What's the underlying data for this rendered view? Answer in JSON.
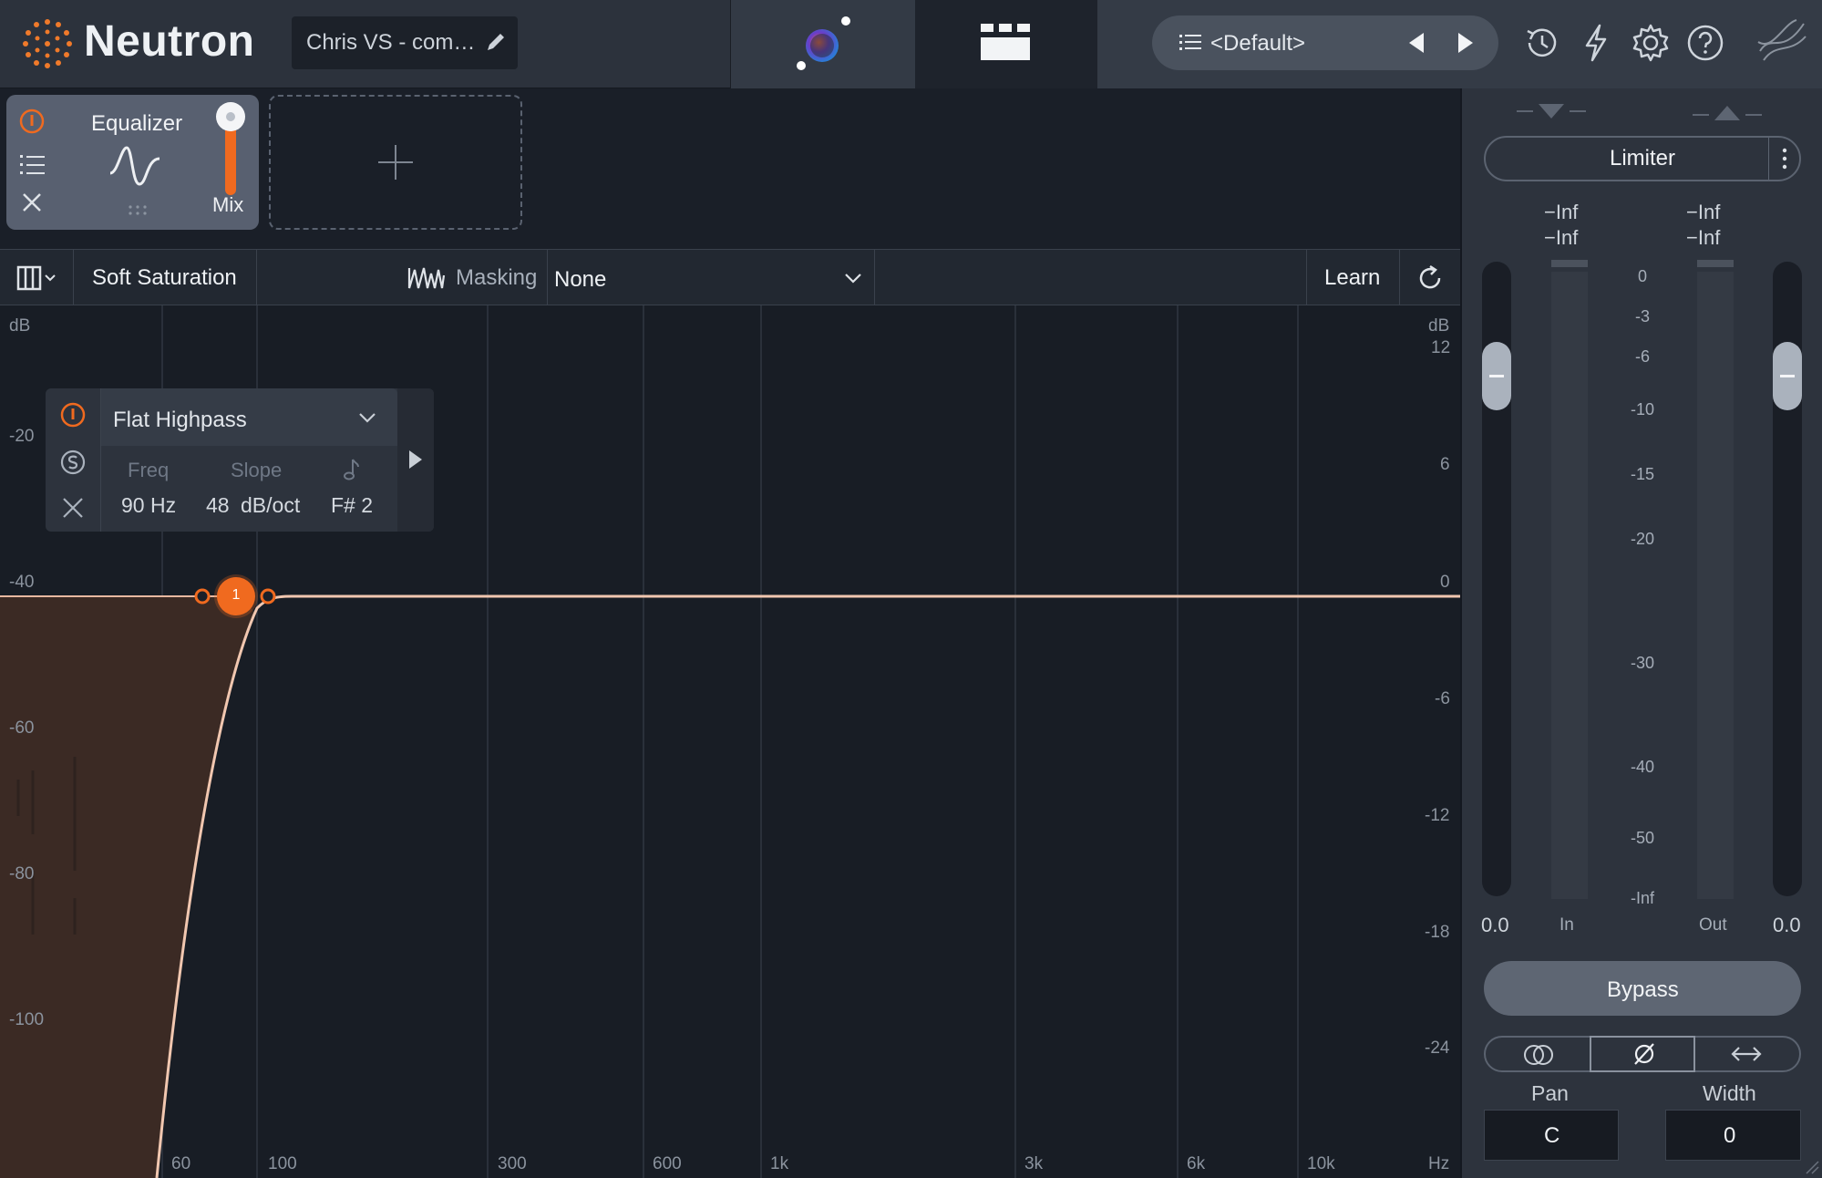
{
  "app": {
    "title": "Neutron"
  },
  "header": {
    "preset_name": "Chris VS - com…",
    "preset_selector": "<Default>"
  },
  "modules": [
    {
      "name": "Equalizer",
      "mix_label": "Mix"
    }
  ],
  "toolbar": {
    "saturation": "Soft Saturation",
    "masking_label": "Masking",
    "masking_value": "None",
    "learn": "Learn"
  },
  "graph": {
    "left_unit": "dB",
    "right_unit": "dB",
    "left_ticks": [
      "-20",
      "-40",
      "-60",
      "-80",
      "-100"
    ],
    "right_ticks": [
      "12",
      "6",
      "0",
      "-6",
      "-12",
      "-18",
      "-24"
    ],
    "freq_ticks": [
      "60",
      "100",
      "300",
      "600",
      "1k",
      "3k",
      "6k",
      "10k"
    ],
    "freq_unit": "Hz"
  },
  "band": {
    "number": "1",
    "type": "Flat Highpass",
    "freq_label": "Freq",
    "slope_label": "Slope",
    "freq_value": "90 Hz",
    "slope_value": "48",
    "slope_unit": "dB/oct",
    "note": "F# 2"
  },
  "output_panel": {
    "module": "Limiter",
    "in_peak": "−Inf",
    "in_rms": "−Inf",
    "out_peak": "−Inf",
    "out_rms": "−Inf",
    "scale": [
      "0",
      "-3",
      "-6",
      "-10",
      "-15",
      "-20",
      "-30",
      "-40",
      "-50",
      "-Inf"
    ],
    "in_gain": "0.0",
    "out_gain": "0.0",
    "in_label": "In",
    "out_label": "Out",
    "bypass": "Bypass",
    "pan_label": "Pan",
    "width_label": "Width",
    "pan_value": "C",
    "width_value": "0"
  },
  "colors": {
    "accent": "#f06a1f",
    "curve": "#f1c7b0"
  }
}
